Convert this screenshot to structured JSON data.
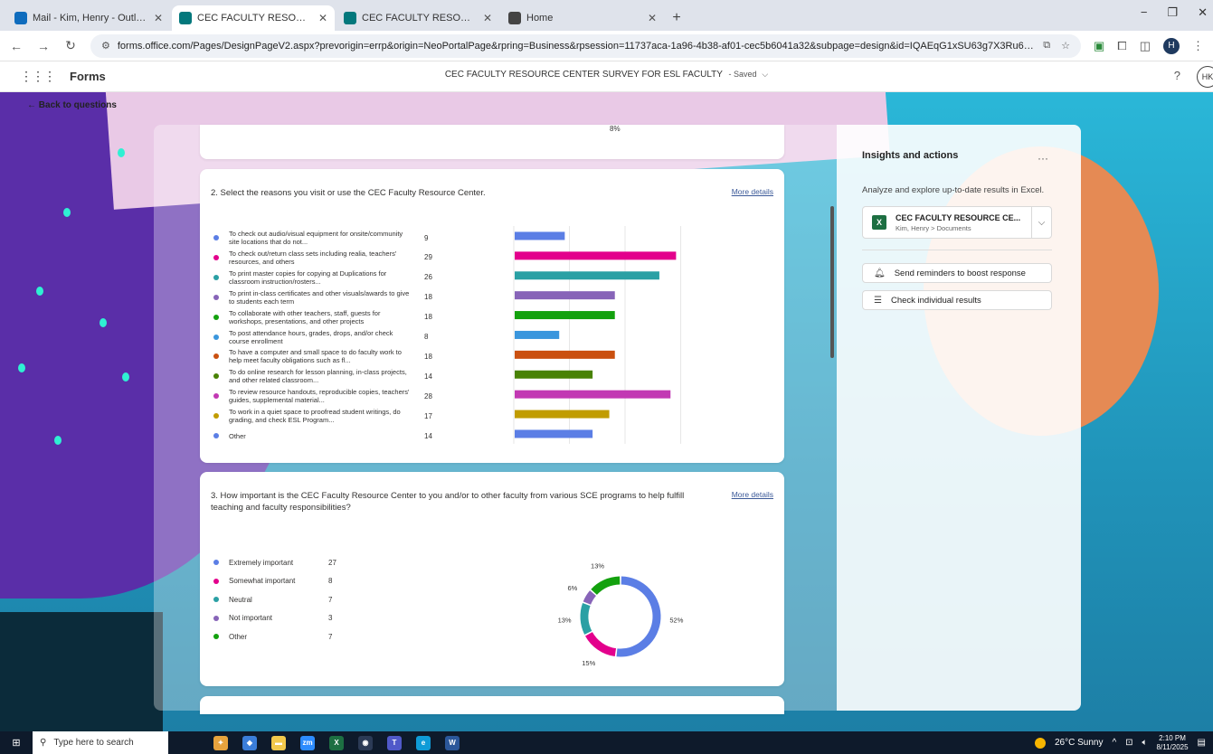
{
  "browser": {
    "tabs": [
      {
        "title": "Mail - Kim, Henry - Outlook",
        "active": false,
        "icon": "outlook-icon",
        "color": "#0f6cbd"
      },
      {
        "title": "CEC FACULTY RESOURCE CENT",
        "active": true,
        "icon": "forms-icon",
        "color": "#03787c"
      },
      {
        "title": "CEC FACULTY RESOURCE CENT",
        "active": false,
        "icon": "forms-icon",
        "color": "#03787c"
      },
      {
        "title": "Home",
        "active": false,
        "icon": "globe-icon",
        "color": "#444444"
      }
    ],
    "url": "forms.office.com/Pages/DesignPageV2.aspx?prevorigin=errp&origin=NeoPortalPage&rpring=Business&rpsession=11737aca-1a96-4b38-af01-cec5b6041a32&subpage=design&id=IQAEqG1xSU63g7X3Ru6os5-A9zxM1rpPs6dTaz-opr1U...",
    "profile_initial": "H"
  },
  "forms_header": {
    "app_name": "Forms",
    "form_title": "CEC FACULTY RESOURCE CENTER SURVEY FOR ESL FACULTY",
    "saved": "- Saved",
    "help": "?",
    "user_initials": "HK"
  },
  "back_link": "Back to questions",
  "card0": {
    "pct": "8%"
  },
  "question2": {
    "title": "2. Select the reasons you visit or use the CEC Faculty Resource Center.",
    "more_details": "More details",
    "options": [
      {
        "label": "To check out audio/visual equipment for onsite/community site locations that do not...",
        "count": "9",
        "color": "#5b7ee5"
      },
      {
        "label": "To check out/return class sets including realia, teachers' resources, and others",
        "count": "29",
        "color": "#e3008c"
      },
      {
        "label": "To print master copies for copying at Duplications for classroom instruction/rosters...",
        "count": "26",
        "color": "#2aa0a4"
      },
      {
        "label": "To print in-class certificates and other visuals/awards to give to students each term",
        "count": "18",
        "color": "#8764b8"
      },
      {
        "label": "To collaborate with other teachers, staff, guests for workshops, presentations, and other projects",
        "count": "18",
        "color": "#13a10e"
      },
      {
        "label": "To post attendance hours, grades, drops, and/or check course enrollment",
        "count": "8",
        "color": "#3a96dd"
      },
      {
        "label": "To have a computer and small space to do faculty work to help meet faculty obligations such as fl...",
        "count": "18",
        "color": "#ca5010"
      },
      {
        "label": "To do online research for lesson planning, in-class projects, and other related classroom...",
        "count": "14",
        "color": "#498205"
      },
      {
        "label": "To review resource handouts, reproducible copies, teachers' guides, supplemental material...",
        "count": "28",
        "color": "#c239b3"
      },
      {
        "label": "To work in a quiet space to proofread student writings, do grading, and check ESL Program...",
        "count": "17",
        "color": "#c19c00"
      },
      {
        "label": "Other",
        "count": "14",
        "color": "#5b7ee5"
      }
    ]
  },
  "question3": {
    "title": "3. How important is the CEC Faculty Resource Center to you and/or to other faculty from various SCE programs to help fulfill teaching and faculty responsibilities?",
    "more_details": "More details",
    "options": [
      {
        "label": "Extremely important",
        "count": "27",
        "color": "#5b7ee5"
      },
      {
        "label": "Somewhat important",
        "count": "8",
        "color": "#e3008c"
      },
      {
        "label": "Neutral",
        "count": "7",
        "color": "#2aa0a4"
      },
      {
        "label": "Not important",
        "count": "3",
        "color": "#8764b8"
      },
      {
        "label": "Other",
        "count": "7",
        "color": "#13a10e"
      }
    ]
  },
  "chart_data": [
    {
      "type": "bar",
      "orientation": "horizontal",
      "categories": [
        "To check out audio/visual equipment for onsite/community site locations that do not...",
        "To check out/return class sets including realia, teachers' resources, and others",
        "To print master copies for copying at Duplications for classroom instruction/rosters...",
        "To print in-class certificates and other visuals/awards to give to students each term",
        "To collaborate with other teachers, staff, guests for workshops, presentations, and other projects",
        "To post attendance hours, grades, drops, and/or check course enrollment",
        "To have a computer and small space to do faculty work to help meet faculty obligations such as fl...",
        "To do online research for lesson planning, in-class projects, and other related classroom...",
        "To review resource handouts, reproducible copies, teachers' guides, supplemental material...",
        "To work in a quiet space to proofread student writings, do grading, and check ESL Program...",
        "Other"
      ],
      "values": [
        9,
        29,
        26,
        18,
        18,
        8,
        18,
        14,
        28,
        17,
        14
      ],
      "colors": [
        "#5b7ee5",
        "#e3008c",
        "#2aa0a4",
        "#8764b8",
        "#13a10e",
        "#3a96dd",
        "#ca5010",
        "#498205",
        "#c239b3",
        "#c19c00",
        "#5b7ee5"
      ],
      "xlim": [
        0,
        33
      ],
      "xticks": [
        0,
        10,
        20,
        30
      ],
      "grid": true
    },
    {
      "type": "pie",
      "donut": true,
      "categories": [
        "Extremely important",
        "Somewhat important",
        "Neutral",
        "Not important",
        "Other"
      ],
      "values": [
        27,
        8,
        7,
        3,
        7
      ],
      "labels": [
        "52%",
        "15%",
        "13%",
        "6%",
        "13%"
      ],
      "colors": [
        "#5b7ee5",
        "#e3008c",
        "#2aa0a4",
        "#8764b8",
        "#13a10e"
      ]
    }
  ],
  "insights": {
    "title": "Insights and actions",
    "more": "···",
    "description": "Analyze and explore up-to-date results in Excel.",
    "file_name": "CEC FACULTY RESOURCE CE...",
    "file_path": "Kim, Henry > Documents",
    "reminder_button": "Send reminders to boost response",
    "individual_button": "Check individual results"
  },
  "taskbar": {
    "search_placeholder": "Type here to search",
    "weather": "26°C  Sunny",
    "time": "2:10 PM",
    "date": "8/11/2025"
  }
}
